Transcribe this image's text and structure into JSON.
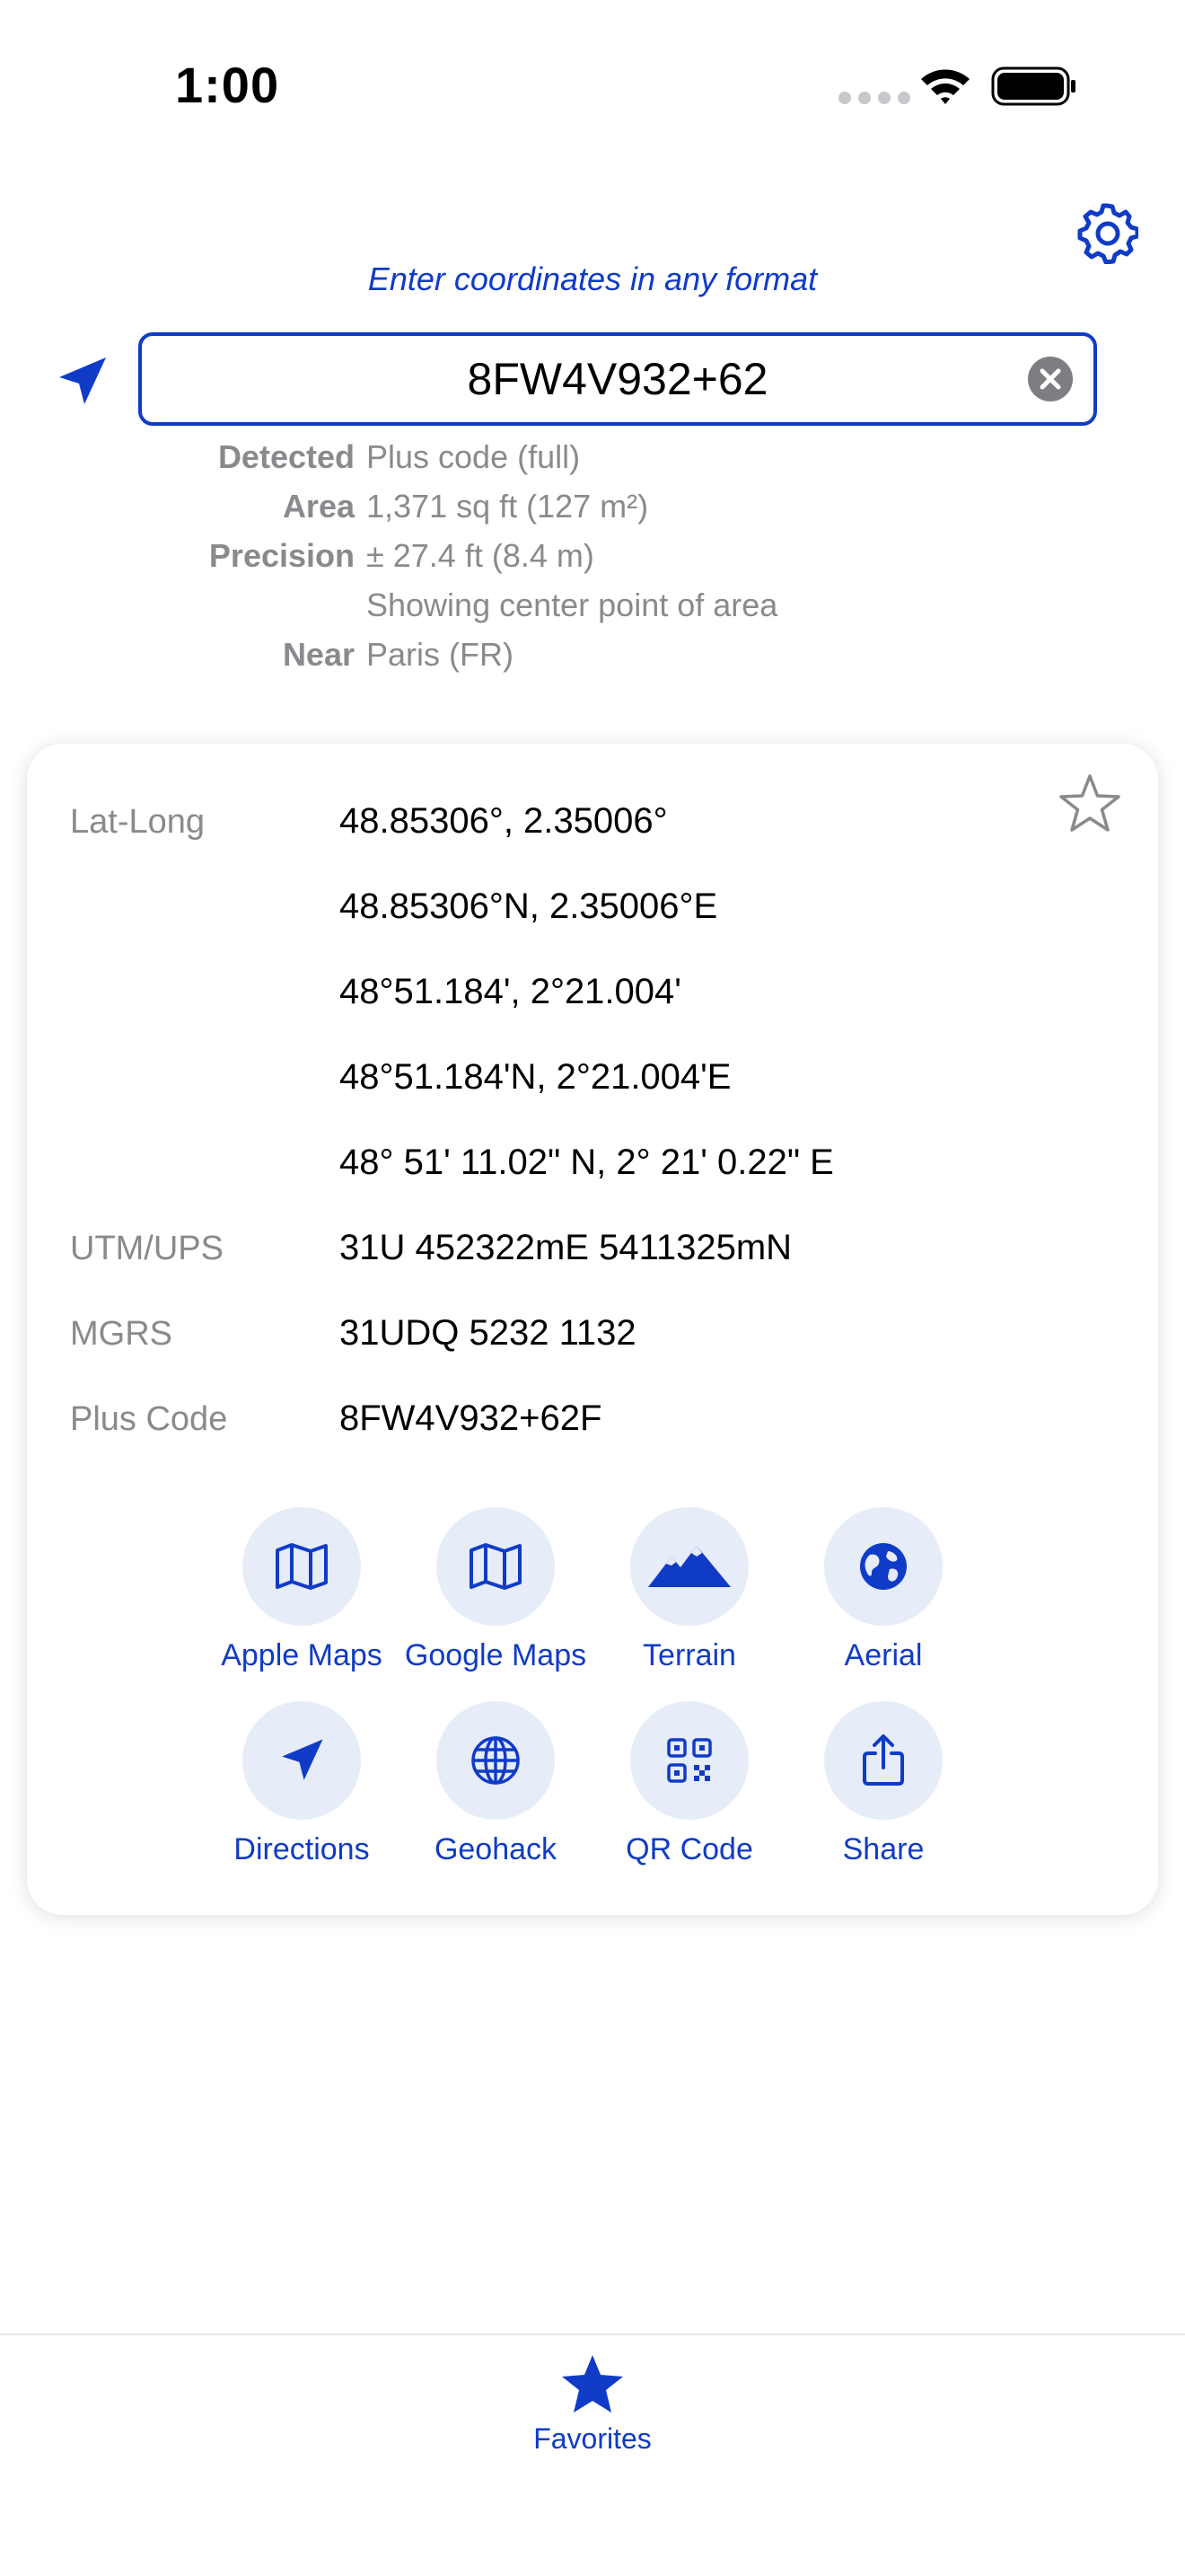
{
  "status_bar": {
    "time": "1:00"
  },
  "header": {
    "hint": "Enter coordinates in any format"
  },
  "search": {
    "value": "8FW4V932+62"
  },
  "detection": [
    {
      "label": "Detected",
      "value": "Plus code (full)"
    },
    {
      "label": "Area",
      "value": "1,371 sq ft (127 m²)"
    },
    {
      "label": "Precision",
      "value": "± 27.4 ft (8.4 m)"
    },
    {
      "label": "",
      "value": "Showing center point of area"
    },
    {
      "label": "Near",
      "value": "Paris (FR)"
    }
  ],
  "result": {
    "rows": [
      {
        "label": "Lat-Long",
        "value": "48.85306°, 2.35006°"
      },
      {
        "label": "",
        "value": "48.85306°N, 2.35006°E"
      },
      {
        "label": "",
        "value": "48°51.184', 2°21.004'"
      },
      {
        "label": "",
        "value": "48°51.184'N, 2°21.004'E"
      },
      {
        "label": "",
        "value": "48° 51' 11.02\" N, 2° 21' 0.22\" E"
      },
      {
        "label": "UTM/UPS",
        "value": "31U 452322mE 5411325mN"
      },
      {
        "label": "MGRS",
        "value": "31UDQ 5232 1132"
      },
      {
        "label": "Plus Code",
        "value": "8FW4V932+62F"
      }
    ],
    "actions": [
      {
        "label": "Apple Maps",
        "icon": "map-icon"
      },
      {
        "label": "Google Maps",
        "icon": "map-icon"
      },
      {
        "label": "Terrain",
        "icon": "mountains-icon"
      },
      {
        "label": "Aerial",
        "icon": "globe-icon"
      },
      {
        "label": "Directions",
        "icon": "location-arrow-icon"
      },
      {
        "label": "Geohack",
        "icon": "globe-grid-icon"
      },
      {
        "label": "QR Code",
        "icon": "qr-code-icon"
      },
      {
        "label": "Share",
        "icon": "share-icon"
      }
    ]
  },
  "tab_bar": {
    "favorites_label": "Favorites"
  },
  "colors": {
    "accent": "#0f3bc7",
    "muted": "#8a8a8e",
    "chip": "#e6ecf8"
  }
}
